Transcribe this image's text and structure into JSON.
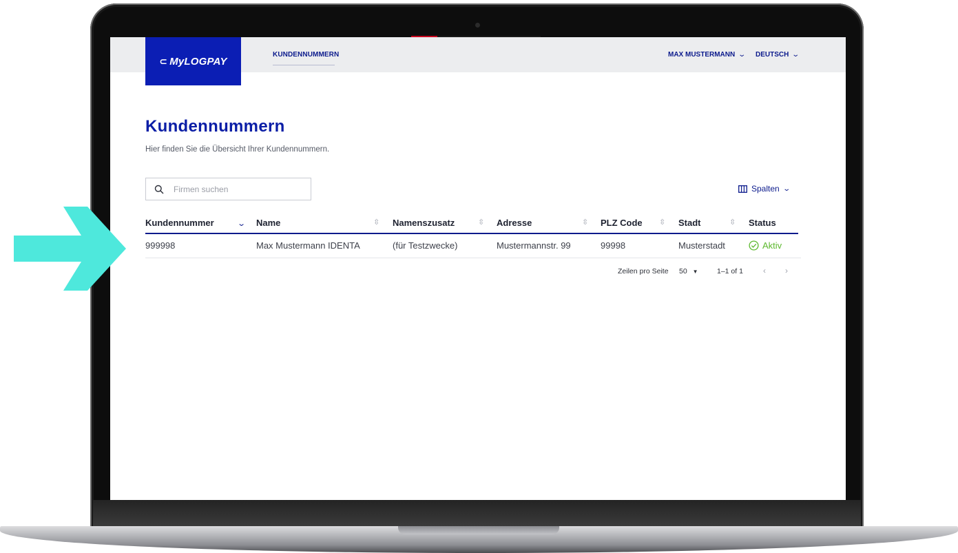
{
  "app": {
    "logo_text": "MyLOGPAY",
    "nav_tab": "KUNDENNUMMERN",
    "user_menu": "MAX MUSTERMANN",
    "language_menu": "DEUTSCH"
  },
  "page": {
    "title": "Kundennummern",
    "subtitle": "Hier finden Sie die Übersicht Ihrer Kundennummern."
  },
  "search": {
    "placeholder": "Firmen suchen"
  },
  "columns_button": {
    "label": "Spalten"
  },
  "table": {
    "headers": [
      "Kundennummer",
      "Name",
      "Namenszusatz",
      "Adresse",
      "PLZ Code",
      "Stadt",
      "Status"
    ],
    "rows": [
      {
        "kundennummer": "999998",
        "name": "Max Mustermann IDENTA",
        "namenszusatz": "(für Testzwecke)",
        "adresse": "Mustermannstr. 99",
        "plz": "99998",
        "stadt": "Musterstadt",
        "status": "Aktiv"
      }
    ]
  },
  "pagination": {
    "rows_per_page_label": "Zeilen pro Seite",
    "rows_per_page_value": "50",
    "range": "1–1 of 1"
  },
  "colors": {
    "brand_blue": "#0b1eb4",
    "nav_text": "#0b1a8c",
    "status_active": "#5cb82e",
    "annotation_arrow": "#4ee8dc"
  },
  "icons": {
    "search": "search-icon",
    "columns": "columns-icon",
    "status": "check-circle-icon",
    "dropdown": "chevron-down-icon"
  }
}
